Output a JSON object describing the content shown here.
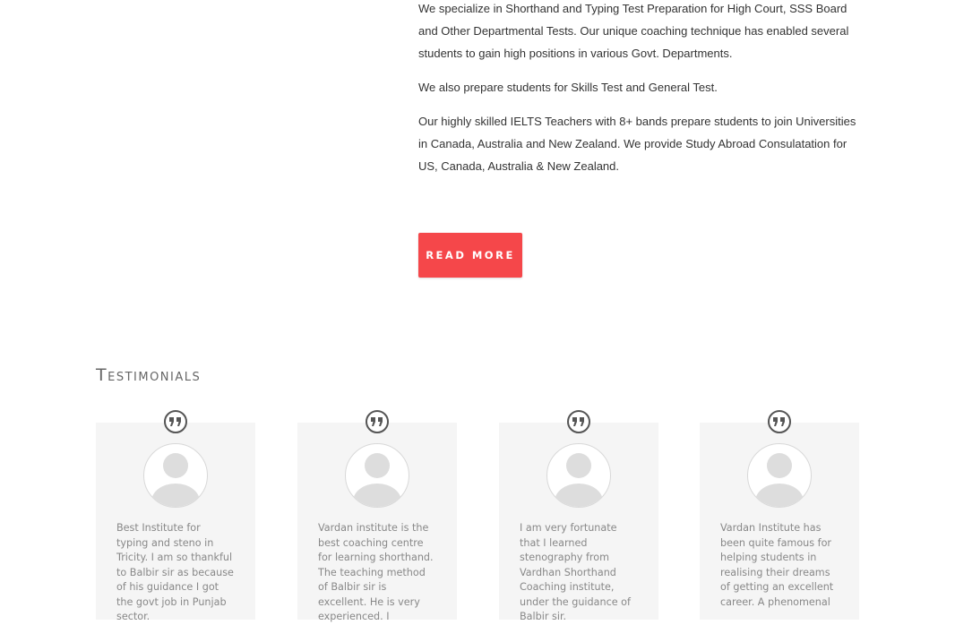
{
  "about": {
    "paragraphs": [
      "We specialize in Shorthand and Typing Test Preparation for High Court, SSS Board and Other Departmental Tests.  Our unique coaching technique has enabled several students to gain high positions in various Govt. Departments.",
      "We also prepare students for Skills Test and General Test.",
      "Our highly skilled IELTS Teachers with 8+ bands prepare students to join Universities in Canada, Australia and New Zealand.  We provide Study Abroad Consulatation for US, Canada, Australia & New Zealand."
    ],
    "read_more_label": "READ MORE"
  },
  "testimonials": {
    "title": "Testimonials",
    "items": [
      {
        "text": "Best Institute for typing and steno in Tricity. I am so thankful to Balbir sir as because of his guidance I got the govt job in Punjab sector."
      },
      {
        "text": "Vardan institute is the best coaching centre for learning shorthand. The teaching method of Balbir sir is excellent. He is very experienced. I"
      },
      {
        "text": "I am very fortunate that I learned stenography from Vardhan Shorthand Coaching institute, under the guidance of Balbir sir."
      },
      {
        "text": "Vardan Institute has been quite famous for helping students in realising their dreams of getting an excellent career. A phenomenal"
      }
    ]
  },
  "colors": {
    "accent": "#f5474a",
    "card_background": "#f5f5f5",
    "body_text": "#333333",
    "muted_text": "#888888"
  },
  "icons": {
    "quote": "quote-icon",
    "avatar": "user-placeholder-icon"
  }
}
